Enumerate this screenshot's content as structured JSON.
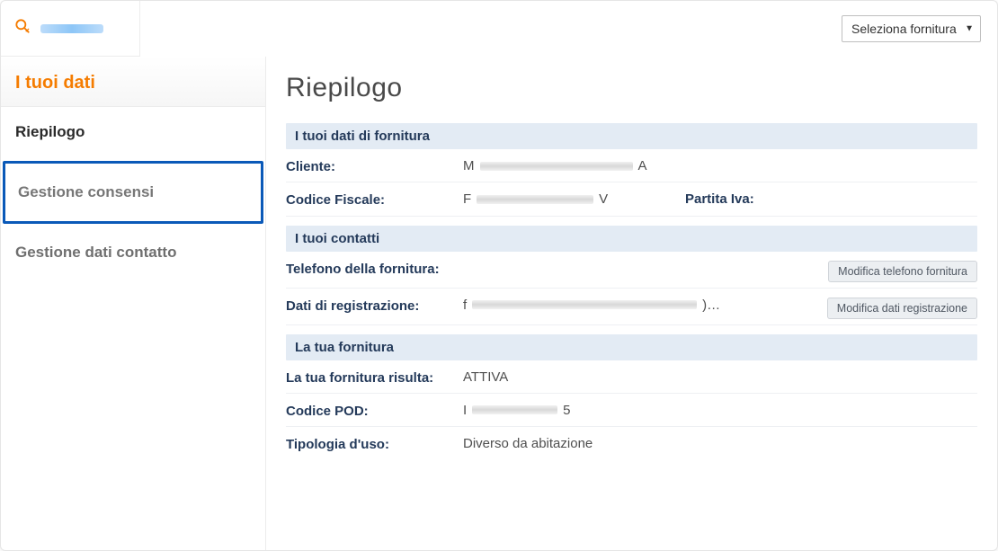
{
  "topbar": {
    "supply_select_label": "Seleziona fornitura"
  },
  "sidebar": {
    "title": "I tuoi dati",
    "items": [
      {
        "label": "Riepilogo"
      },
      {
        "label": "Gestione consensi"
      },
      {
        "label": "Gestione dati contatto"
      }
    ]
  },
  "main": {
    "title": "Riepilogo",
    "section_supply_data": {
      "header": "I tuoi dati di fornitura",
      "cliente_label": "Cliente:",
      "cliente_prefix": "M",
      "cliente_suffix": "A",
      "cf_label": "Codice Fiscale:",
      "cf_prefix": "F",
      "cf_suffix": "V",
      "piva_label": "Partita Iva:"
    },
    "section_contacts": {
      "header": "I tuoi contatti",
      "phone_label": "Telefono della fornitura:",
      "modify_phone_btn": "Modifica telefono fornitura",
      "reg_label": "Dati di registrazione:",
      "reg_prefix": "f",
      "reg_suffix": ")…",
      "modify_reg_btn": "Modifica dati registrazione"
    },
    "section_supply": {
      "header": "La tua fornitura",
      "status_label": "La tua fornitura risulta:",
      "status_value": "ATTIVA",
      "pod_label": "Codice POD:",
      "pod_prefix": "I",
      "pod_suffix": "5",
      "usage_label": "Tipologia d'uso:",
      "usage_value": "Diverso da abitazione"
    }
  }
}
